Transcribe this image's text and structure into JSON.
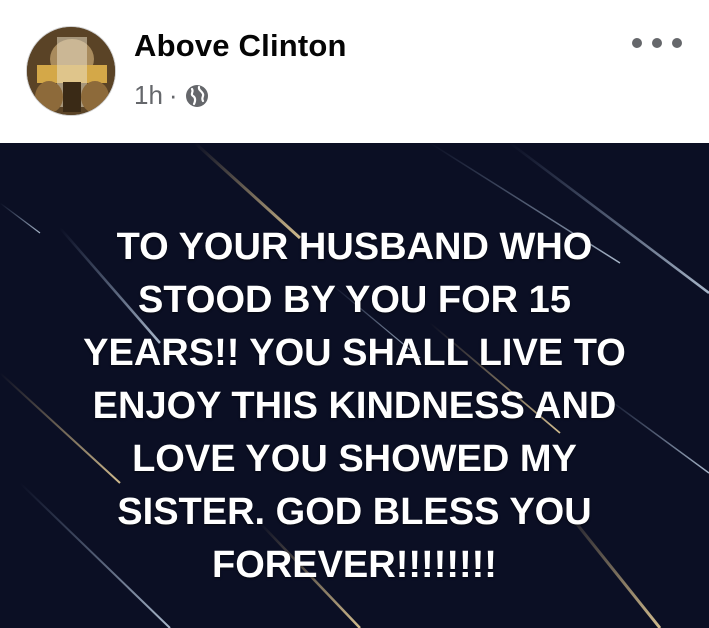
{
  "post": {
    "author_name": "Above Clinton",
    "time": "1h",
    "separator": "·",
    "audience_icon": "globe-icon",
    "more_icon": "more-options-icon",
    "text": "TO  YOUR HUSBAND WHO\nSTOOD BY YOU FOR 15\nYEARS!!  YOU SHALL LIVE TO\nENJOY THIS KINDNESS AND\nLOVE YOU SHOWED MY\nSISTER. GOD BLESS YOU\nFOREVER!!!!!!!!",
    "background_color": "#0b0f24",
    "text_color": "#ffffff"
  }
}
